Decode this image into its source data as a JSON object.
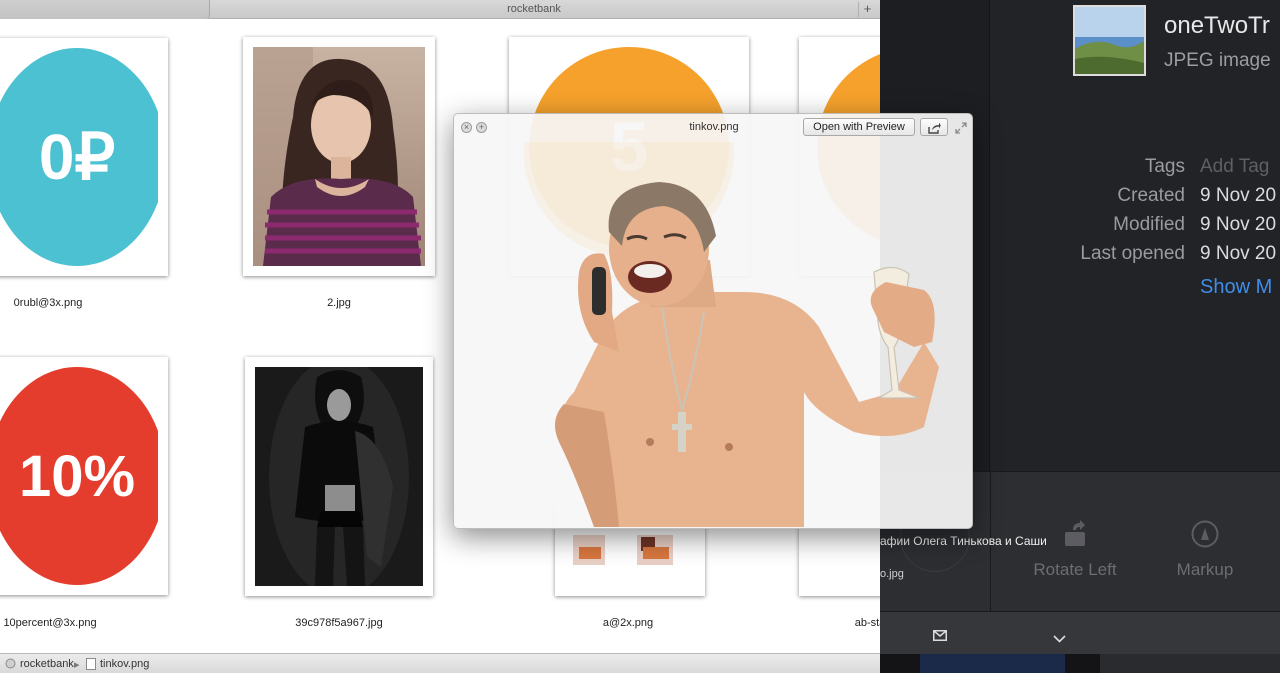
{
  "finder": {
    "window_title": "rocketbank",
    "new_tab_label": "+",
    "files": [
      {
        "name": "0rubl@3x.png",
        "text": "0₽",
        "color": "#4cc1d2"
      },
      {
        "name": "2.jpg"
      },
      {
        "name": "",
        "text": "5",
        "color": "#f5a12c"
      },
      {
        "name": ""
      },
      {
        "name": "10percent@3x.png",
        "text": "10%",
        "color": "#e53d2d"
      },
      {
        "name": "39c978f5a967.jpg"
      },
      {
        "name": "a@2x.png"
      },
      {
        "name": "ab-sta"
      }
    ],
    "path": [
      "rocketbank",
      "tinkov.png"
    ],
    "path_separator": "▸"
  },
  "quicklook": {
    "title": "tinkov.png",
    "open_with_label": "Open with Preview",
    "close_glyph": "×",
    "fullscreen_glyph": "+"
  },
  "info_panel": {
    "title": "oneTwoTr",
    "subtitle": "JPEG image",
    "tags_label": "Tags",
    "tags_value": "Add Tag",
    "created_label": "Created",
    "created_value": "9 Nov 20",
    "modified_label": "Modified",
    "modified_value": "9 Nov 20",
    "last_opened_label": "Last opened",
    "last_opened_value": "9 Nov 20",
    "show_more": "Show M",
    "caption_overlay": "афии Олега Тинькова и Саши",
    "caption_overlay_2": "o.jpg",
    "rotate_left": "Rotate Left",
    "markup": "Markup"
  },
  "colors": {
    "accent_link": "#3f8ee8",
    "panel_bg": "#222326"
  }
}
